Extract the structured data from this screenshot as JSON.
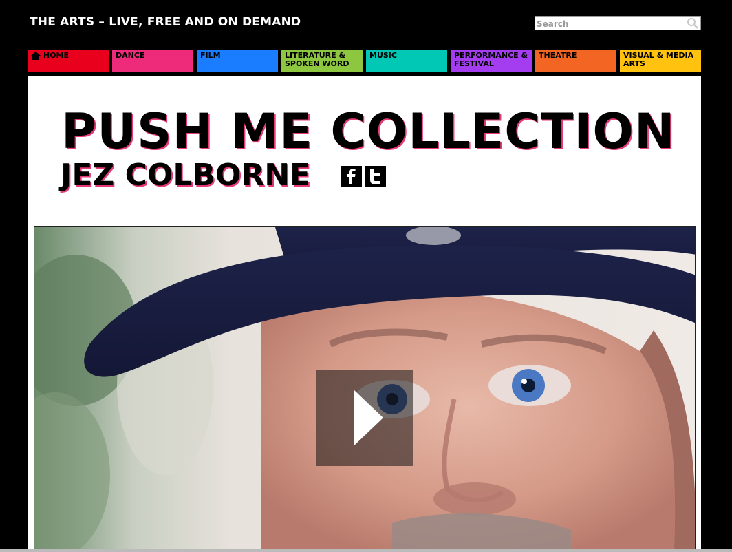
{
  "header": {
    "site_title": "THE ARTS – LIVE, FREE AND ON DEMAND",
    "search_placeholder": "Search"
  },
  "nav": {
    "items": [
      {
        "label": "HOME",
        "color": "#e8001c",
        "icon": "home-icon"
      },
      {
        "label": "DANCE",
        "color": "#ee2a7b"
      },
      {
        "label": "FILM",
        "color": "#1a7dff"
      },
      {
        "label": "LITERATURE & SPOKEN WORD",
        "color": "#8dc63f"
      },
      {
        "label": "MUSIC",
        "color": "#00c8b4"
      },
      {
        "label": "PERFORMANCE & FESTIVAL",
        "color": "#a43cf0"
      },
      {
        "label": "THEATRE",
        "color": "#f26522"
      },
      {
        "label": "VISUAL & MEDIA ARTS",
        "color": "#ffc20e"
      }
    ]
  },
  "page": {
    "title": "PUSH ME COLLECTION",
    "artist": "JEZ COLBORNE",
    "social": [
      {
        "icon": "facebook-icon"
      },
      {
        "icon": "twitter-icon"
      }
    ]
  },
  "video": {
    "play_icon": "play-icon",
    "poster": "close-up portrait of a man wearing a dark blue hat"
  }
}
